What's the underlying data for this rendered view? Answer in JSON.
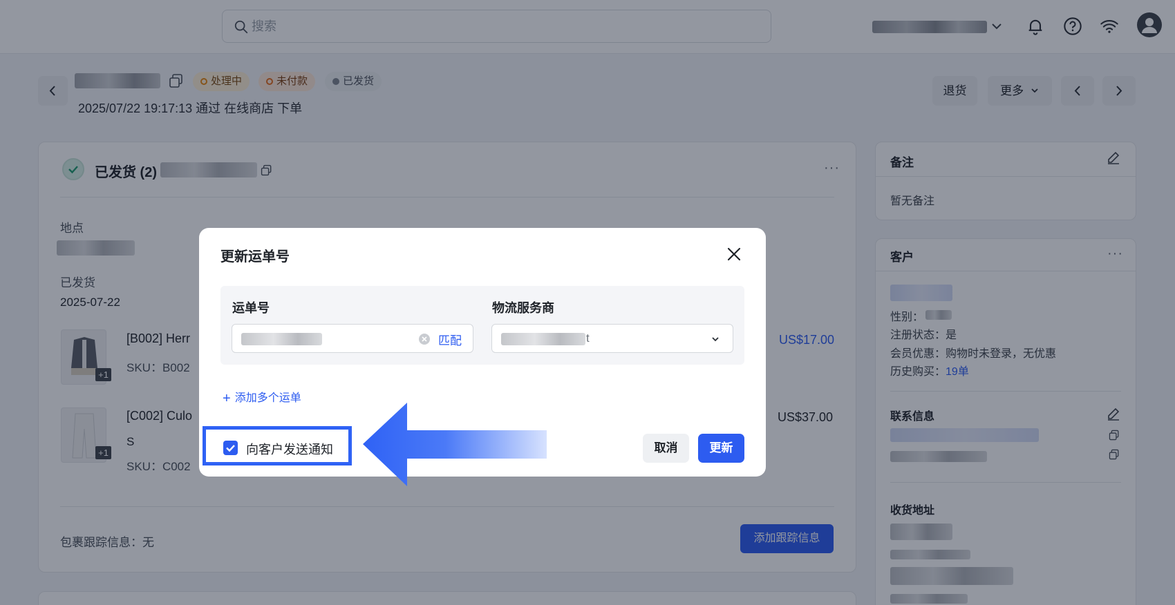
{
  "header": {
    "search_placeholder": "搜索"
  },
  "order": {
    "tags": [
      "处理中",
      "未付款",
      "已发货"
    ],
    "subtitle": "2025/07/22 19:17:13 通过 在线商店 下单",
    "actions": {
      "return": "退货",
      "more": "更多"
    }
  },
  "fulfillment": {
    "title": "已发货 (2)",
    "location_label": "地点",
    "shipped_label": "已发货",
    "shipped_date": "2025-07-22",
    "items": [
      {
        "name": "[B002] Herr",
        "sku": "SKU：B002",
        "price": "US$17.00",
        "badge": "+1"
      },
      {
        "name": "[C002] Culo",
        "variant": "S",
        "sku": "SKU：C002",
        "price": "US$37.00",
        "badge": "+1"
      }
    ],
    "tracking_label": "包裹跟踪信息：无",
    "add_tracking": "添加跟踪信息"
  },
  "sidebar": {
    "notes": {
      "title": "备注",
      "empty": "暂无备注"
    },
    "customer": {
      "title": "客户",
      "gender": "性别：",
      "registered": "注册状态：是",
      "discount": "会员优惠：购物时未登录，无优惠",
      "history_label": "历史购买：",
      "history_value": "19单"
    },
    "contact": {
      "title": "联系信息"
    },
    "shipping": {
      "title": "收货地址"
    }
  },
  "modal": {
    "title": "更新运单号",
    "tracking_label": "运单号",
    "carrier_label": "物流服务商",
    "carrier_value_tail": "t",
    "match": "匹配",
    "add_more": "添加多个运单",
    "notify_label": "向客户发送通知",
    "notify_checked": true,
    "cancel": "取消",
    "update": "更新"
  },
  "colors": {
    "primary": "#2d5cf0",
    "highlight_border": "#2f62f5"
  }
}
